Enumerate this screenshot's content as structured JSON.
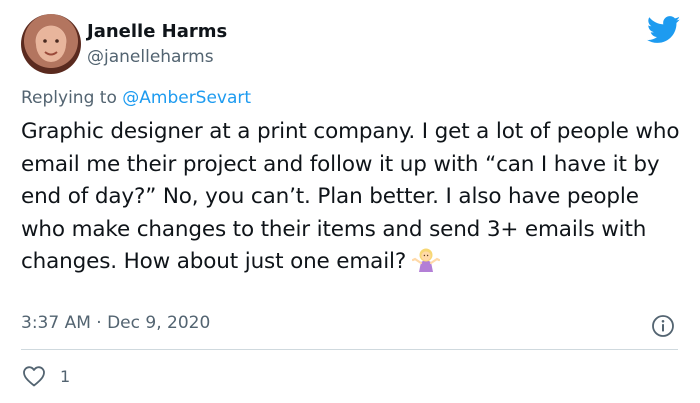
{
  "author": {
    "name": "Janelle Harms",
    "handle": "@janelleharms",
    "avatar_icon": "profile-photo"
  },
  "platform_icon": "twitter-bird-icon",
  "reply": {
    "prefix": "Replying to ",
    "mention": "@AmberSevart"
  },
  "tweet": {
    "text": "Graphic designer at a print company. I get a lot of people who email me their project and follow it up with “can I have it by end of day?” No, you can’t. Plan better. I also have people who make changes to their items and send 3+ emails with changes. How about just one email?",
    "emoji": "person-shrugging-emoji"
  },
  "meta": {
    "timestamp": "3:37 AM · Dec 9, 2020",
    "info_icon": "info-icon"
  },
  "actions": {
    "like_icon": "heart-icon",
    "like_count": "1"
  },
  "colors": {
    "brand": "#1d9bf0",
    "text": "#0f1419",
    "muted": "#536471",
    "divider": "#cfd9de"
  }
}
